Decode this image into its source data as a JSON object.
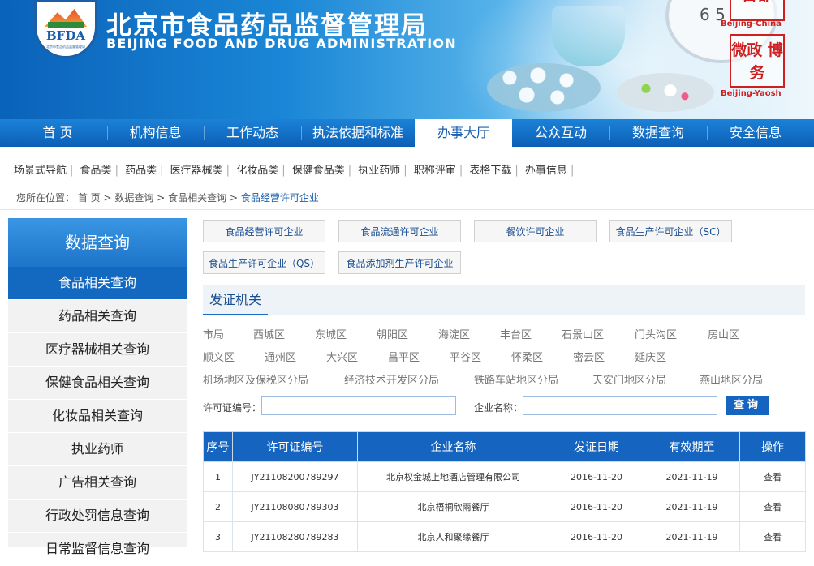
{
  "header": {
    "logo_text": "BFDA",
    "logo_subtext": "北京市食品药品监督管理局",
    "title_cn": "北京市食品药品监督管理局",
    "title_en": "BEIJING FOOD AND DRUG ADMINISTRATION",
    "clock_digit": "6 5",
    "stamps": [
      {
        "text": "首都",
        "caption": "Beijing-China"
      },
      {
        "text": "微政 博务",
        "caption": "Beijing-Yaosh"
      }
    ]
  },
  "nav": {
    "items": [
      {
        "label": "首 页",
        "active": false
      },
      {
        "label": "机构信息",
        "active": false
      },
      {
        "label": "工作动态",
        "active": false
      },
      {
        "label": "执法依据和标准",
        "active": false
      },
      {
        "label": "办事大厅",
        "active": true
      },
      {
        "label": "公众互动",
        "active": false
      },
      {
        "label": "数据查询",
        "active": false
      },
      {
        "label": "安全信息",
        "active": false
      }
    ]
  },
  "subnav": {
    "items": [
      "场景式导航",
      "食品类",
      "药品类",
      "医疗器械类",
      "化妆品类",
      "保健食品类",
      "执业药师",
      "职称评审",
      "表格下载",
      "办事信息"
    ]
  },
  "breadcrumb": {
    "prefix": "您所在位置：",
    "items": [
      "首 页",
      "数据查询",
      "食品相关查询"
    ],
    "current": "食品经营许可企业",
    "separator": ">"
  },
  "sidebar": {
    "title": "数据查询",
    "items": [
      {
        "label": "食品相关查询",
        "active": true
      },
      {
        "label": "药品相关查询",
        "active": false
      },
      {
        "label": "医疗器械相关查询",
        "active": false
      },
      {
        "label": "保健食品相关查询",
        "active": false
      },
      {
        "label": "化妆品相关查询",
        "active": false
      },
      {
        "label": "执业药师",
        "active": false
      },
      {
        "label": "广告相关查询",
        "active": false
      },
      {
        "label": "行政处罚信息查询",
        "active": false
      },
      {
        "label": "日常监督信息查询",
        "active": false
      }
    ]
  },
  "query_buttons": [
    "食品经营许可企业",
    "食品流通许可企业",
    "餐饮许可企业",
    "食品生产许可企业（SC）",
    "食品生产许可企业（QS）",
    "食品添加剂生产许可企业"
  ],
  "issuing_authority": {
    "title": "发证机关",
    "districts_row1": [
      "市局",
      "西城区",
      "东城区",
      "朝阳区",
      "海淀区",
      "丰台区",
      "石景山区",
      "门头沟区",
      "房山区"
    ],
    "districts_row2": [
      "顺义区",
      "通州区",
      "大兴区",
      "昌平区",
      "平谷区",
      "怀柔区",
      "密云区",
      "延庆区"
    ],
    "districts_row3": [
      "机场地区及保税区分局",
      "经济技术开发区分局",
      "铁路车站地区分局",
      "天安门地区分局",
      "燕山地区分局"
    ]
  },
  "search": {
    "license_label": "许可证编号：",
    "license_value": "",
    "company_label": "企业名称：",
    "company_value": "",
    "button_label": "查询"
  },
  "table": {
    "columns": [
      "序号",
      "许可证编号",
      "企业名称",
      "发证日期",
      "有效期至",
      "操作"
    ],
    "rows": [
      [
        "1",
        "JY21108200789297",
        "北京权金城上地酒店管理有限公司",
        "2016-11-20",
        "2021-11-19",
        "查看"
      ],
      [
        "2",
        "JY21108080789303",
        "北京梧桐欣雨餐厅",
        "2016-11-20",
        "2021-11-19",
        "查看"
      ],
      [
        "3",
        "JY21108280789283",
        "北京人和聚缘餐厅",
        "2016-11-20",
        "2021-11-19",
        "查看"
      ]
    ]
  }
}
